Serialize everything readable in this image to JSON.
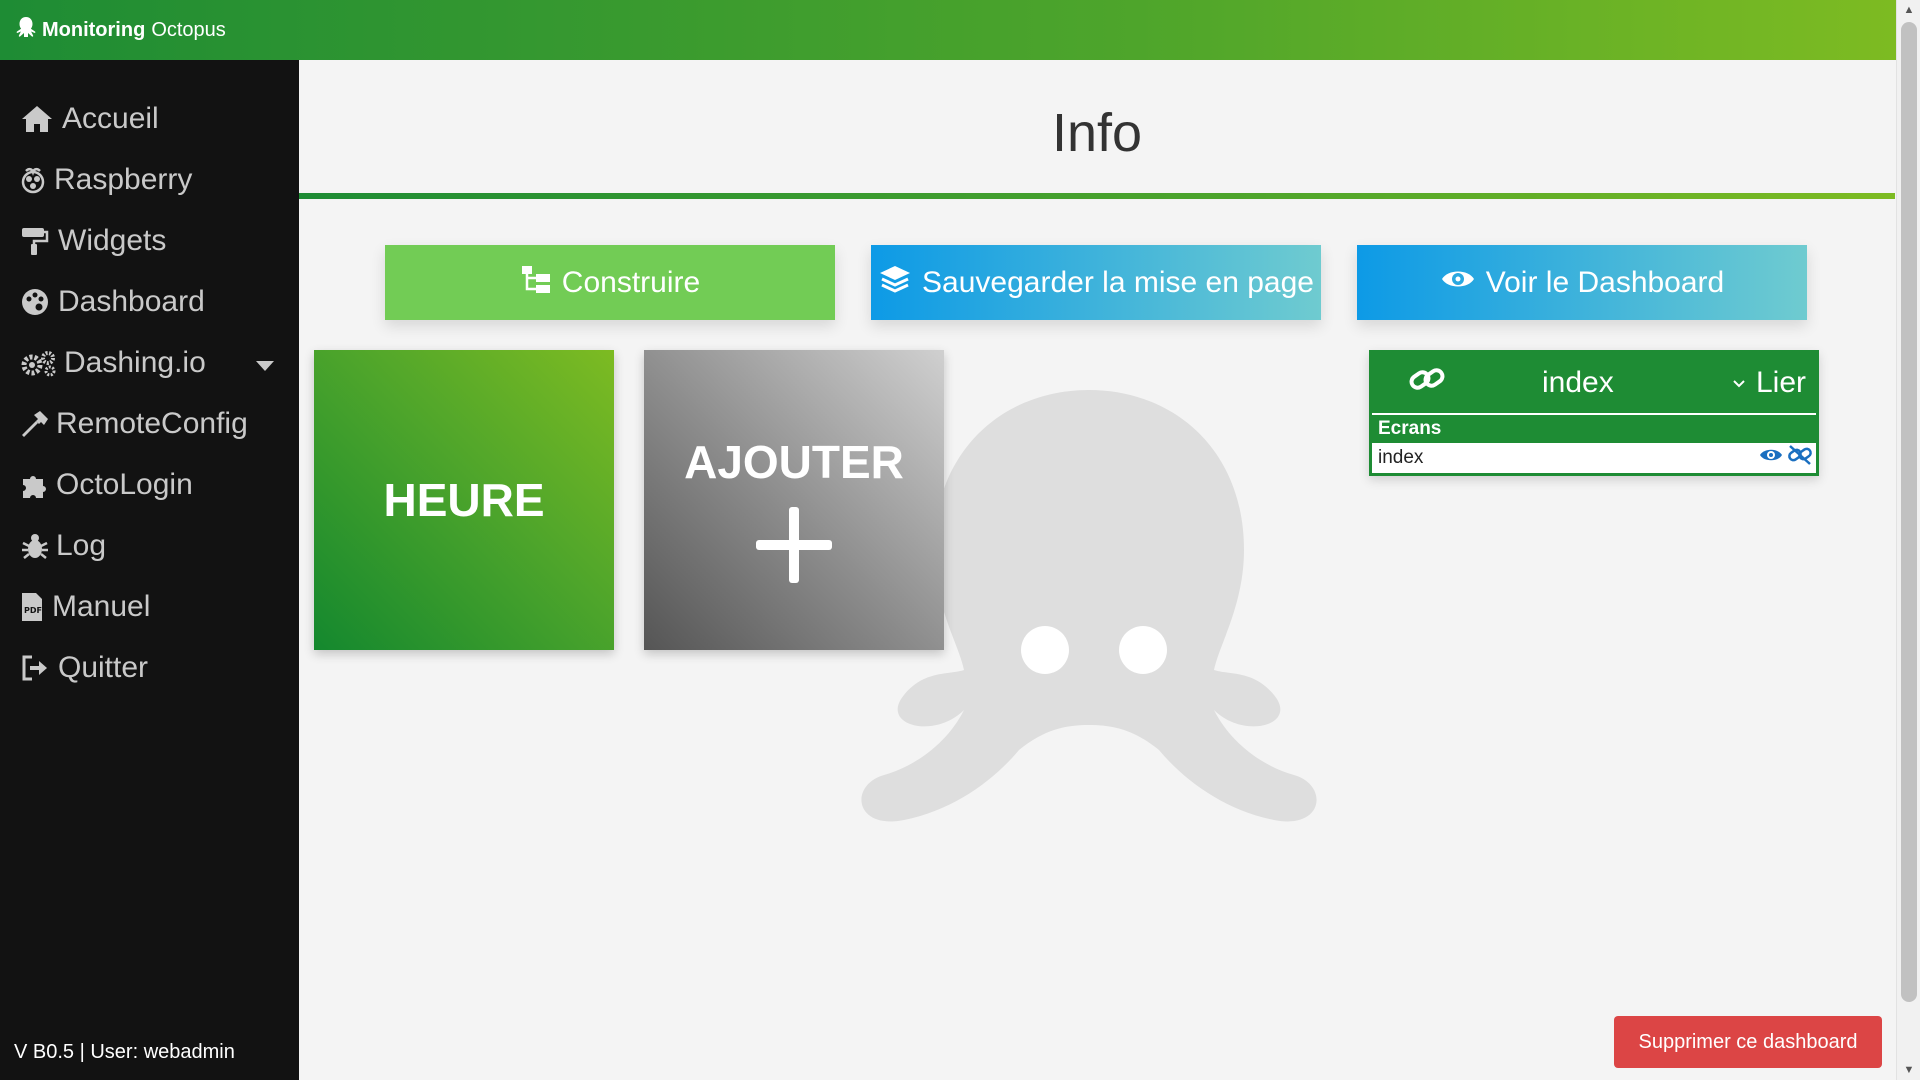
{
  "app": {
    "brand_bold": "Monitoring",
    "brand_rest": "Octopus"
  },
  "sidebar": {
    "items": [
      {
        "label": "Accueil",
        "icon": "home-icon"
      },
      {
        "label": "Raspberry",
        "icon": "raspberry-icon"
      },
      {
        "label": "Widgets",
        "icon": "paint-roller-icon"
      },
      {
        "label": "Dashboard",
        "icon": "palette-icon"
      },
      {
        "label": "Dashing.io",
        "icon": "cogs-icon"
      },
      {
        "label": "RemoteConfig",
        "icon": "hammer-icon"
      },
      {
        "label": "OctoLogin",
        "icon": "puzzle-icon"
      },
      {
        "label": "Log",
        "icon": "bug-icon"
      },
      {
        "label": "Manuel",
        "icon": "pdf-icon"
      },
      {
        "label": "Quitter",
        "icon": "sign-out-icon"
      }
    ],
    "version": "V B0.5 | User: webadmin"
  },
  "main": {
    "title": "Info",
    "buttons": {
      "build": "Construire",
      "save": "Sauvegarder la mise en page",
      "view": "Voir le Dashboard"
    },
    "tiles": {
      "heure": "HEURE",
      "add": "AJOUTER"
    },
    "link_panel": {
      "selected": "index",
      "link_label": "Lier",
      "screens_title": "Ecrans",
      "screens": [
        "index"
      ]
    },
    "delete_label": "Supprimer ce dashboard"
  },
  "colors": {
    "brand_green": "#1e8c34",
    "light_green": "#7dbb22",
    "danger": "#dc4545",
    "blue": "#0d9ae6"
  }
}
